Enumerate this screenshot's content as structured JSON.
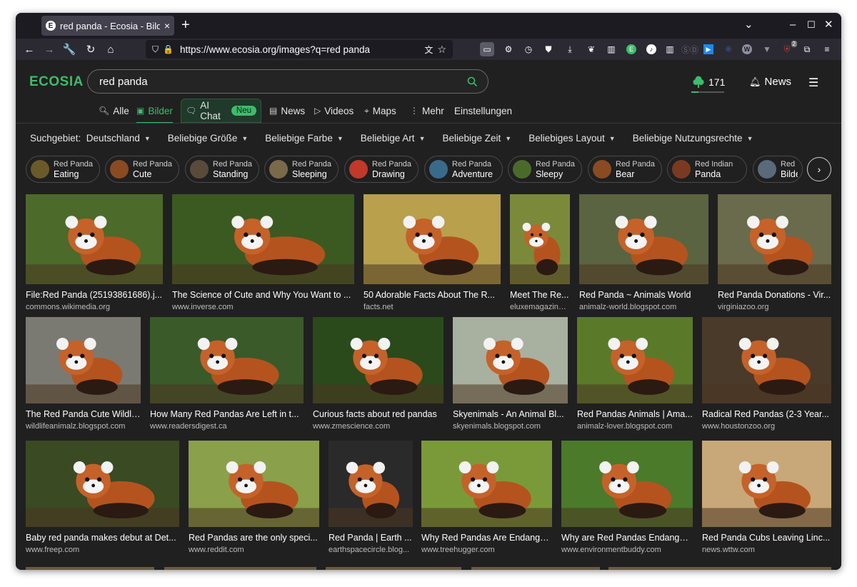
{
  "browser": {
    "tab_title": "red panda - Ecosia - Bilder",
    "tab_favicon": "E",
    "url": "https://www.ecosia.org/images?q=red panda"
  },
  "site": {
    "logo": "ECOSIA",
    "search_value": "red panda",
    "tree_count": "171",
    "news_label": "News"
  },
  "search_tabs": [
    {
      "label": "Alle",
      "icon": "search-icon"
    },
    {
      "label": "Bilder",
      "icon": "image-icon"
    },
    {
      "label": "AI Chat",
      "icon": "chat-icon",
      "badge": "Neu"
    },
    {
      "label": "News",
      "icon": "news-icon"
    },
    {
      "label": "Videos",
      "icon": "play-icon"
    },
    {
      "label": "Maps",
      "icon": "pin-icon"
    },
    {
      "label": "Mehr",
      "icon": "more-icon"
    },
    {
      "label": "Einstellungen"
    }
  ],
  "filters": [
    {
      "label": "Suchgebiet:  Deutschland"
    },
    {
      "label": "Beliebige Größe"
    },
    {
      "label": "Beliebige Farbe"
    },
    {
      "label": "Beliebige Art"
    },
    {
      "label": "Beliebige Zeit"
    },
    {
      "label": "Beliebiges Layout"
    },
    {
      "label": "Beliebige Nutzungsrechte"
    }
  ],
  "chips": [
    {
      "line1": "Red Panda",
      "line2": "Eating"
    },
    {
      "line1": "Red Panda",
      "line2": "Cute"
    },
    {
      "line1": "Red Panda",
      "line2": "Standing"
    },
    {
      "line1": "Red Panda",
      "line2": "Sleeping"
    },
    {
      "line1": "Red Panda",
      "line2": "Drawing"
    },
    {
      "line1": "Red Panda",
      "line2": "Adventure"
    },
    {
      "line1": "Red Panda",
      "line2": "Sleepy"
    },
    {
      "line1": "Red Panda",
      "line2": "Bear"
    },
    {
      "line1": "Red Indian",
      "line2": "Panda"
    },
    {
      "line1": "Red Pa",
      "line2": "Bilder"
    }
  ],
  "results": [
    {
      "title": "File:Red Panda (25193861686).j...",
      "source": "commons.wikimedia.org",
      "bg": "#4c6a2a"
    },
    {
      "title": "The Science of Cute and Why You Want to ...",
      "source": "www.inverse.com",
      "bg": "#3a5a22"
    },
    {
      "title": "50 Adorable Facts About The R...",
      "source": "facts.net",
      "bg": "#b8a04c"
    },
    {
      "title": "Meet The Re...",
      "source": "eluxemagazine....",
      "bg": "#7a8a3a"
    },
    {
      "title": "Red Panda ~ Animals World",
      "source": "animalz-world.blogspot.com",
      "bg": "#5a6440"
    },
    {
      "title": "Red Panda Donations - Vir...",
      "source": "virginiazoo.org",
      "bg": "#6a6a4c"
    },
    {
      "title": "The Red Panda Cute Wildli...",
      "source": "wildlifeanimalz.blogspot.com",
      "bg": "#7a7a72"
    },
    {
      "title": "How Many Red Pandas Are Left in t...",
      "source": "www.readersdigest.ca",
      "bg": "#3a5a2a"
    },
    {
      "title": "Curious facts about red pandas",
      "source": "www.zmescience.com",
      "bg": "#2a4a1c"
    },
    {
      "title": "Skyenimals - An Animal Bl...",
      "source": "skyenimals.blogspot.com",
      "bg": "#a8b0a0"
    },
    {
      "title": "Red Pandas Animals | Ama...",
      "source": "animalz-lover.blogspot.com",
      "bg": "#5a7a2a"
    },
    {
      "title": "Radical Red Pandas (2-3 Year...",
      "source": "www.houstonzoo.org",
      "bg": "#4a3a2a"
    },
    {
      "title": "Baby red panda makes debut at Det...",
      "source": "www.freep.com",
      "bg": "#3a4a22"
    },
    {
      "title": "Red Pandas are the only speci...",
      "source": "www.reddit.com",
      "bg": "#8aa04a"
    },
    {
      "title": "Red Panda | Earth ...",
      "source": "earthspacecircle.blog...",
      "bg": "#2a2a2a"
    },
    {
      "title": "Why Red Pandas Are Endange...",
      "source": "www.treehugger.com",
      "bg": "#7a9a3a"
    },
    {
      "title": "Why are Red Pandas Endanger...",
      "source": "www.environmentbuddy.com",
      "bg": "#4a7a2a"
    },
    {
      "title": "Red Panda Cubs Leaving Linc...",
      "source": "news.wttw.com",
      "bg": "#c8a878"
    }
  ],
  "colors": {
    "accent": "#3cbc6c",
    "panda": "#b5531e",
    "panda_dark": "#2a1a12"
  }
}
